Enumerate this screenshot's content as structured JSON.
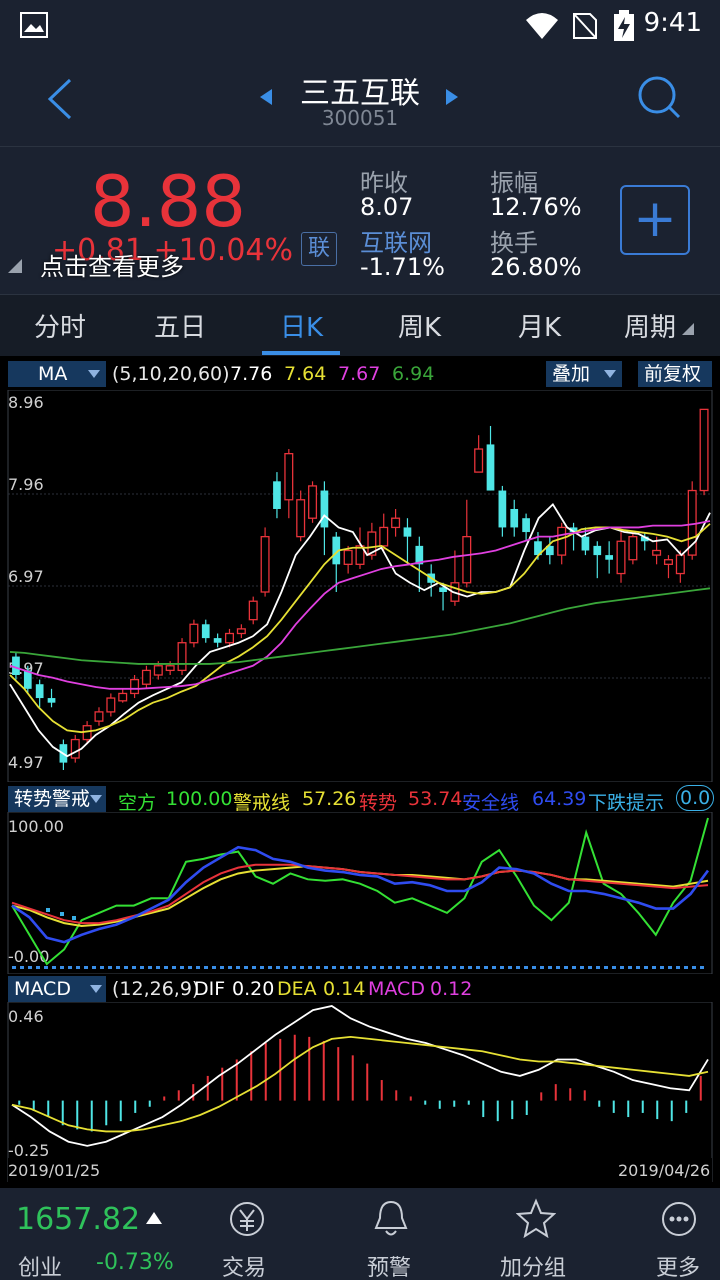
{
  "status": {
    "time": "9:41"
  },
  "header": {
    "name": "三五互联",
    "code": "300051"
  },
  "quote": {
    "price": "8.88",
    "change": "+0.81  +10.04%",
    "hint": "点击查看更多",
    "badge": "联",
    "prev_close_label": "昨收",
    "prev_close": "8.07",
    "sector_label": "互联网",
    "sector_change": "-1.71%",
    "amplitude_label": "振幅",
    "amplitude": "12.76%",
    "turnover_label": "换手",
    "turnover": "26.80%"
  },
  "tabs": [
    "分时",
    "五日",
    "日K",
    "周K",
    "月K",
    "周期"
  ],
  "ma_row": {
    "selector": "MA",
    "params": "(5,10,20,60)",
    "v1": "7.76",
    "v2": "7.64",
    "v3": "7.67",
    "v4": "6.94",
    "overlay": "叠加",
    "adjust": "前复权"
  },
  "trend_row": {
    "selector": "转势警戒",
    "l1": "空方",
    "v1": "100.00",
    "l2": "警戒线",
    "v2": "57.26",
    "l3": "转势",
    "v3": "53.74",
    "l4": "安全线",
    "v4": "64.39",
    "l5": "下跌提示",
    "v5": "0.0"
  },
  "macd_row": {
    "selector": "MACD",
    "params": "(12,26,9)",
    "dif_label": "DIF",
    "dif": "0.20",
    "dea_label": "DEA",
    "dea": "0.14",
    "macd_label": "MACD",
    "macd": "0.12"
  },
  "axes": {
    "price_ticks": [
      "8.96",
      "7.96",
      "6.97",
      "5.97",
      "4.97"
    ],
    "trend_ticks": [
      "100.00",
      "-0.00"
    ],
    "macd_ticks": [
      "0.46",
      "-0.25"
    ],
    "start_date": "2019/01/25",
    "end_date": "2019/04/26"
  },
  "bottom": {
    "index_value": "1657.82",
    "index_name": "创业",
    "index_change": "-0.73%",
    "nav": [
      "交易",
      "预警",
      "加分组",
      "更多"
    ]
  },
  "colors": {
    "up": "#e8333a",
    "down": "#4fe6e6",
    "ma5": "#ffffff",
    "ma10": "#e6e034",
    "ma20": "#e040e0",
    "ma60": "#3aa63a"
  },
  "chart_data": [
    {
      "type": "line",
      "title": "",
      "ylim": [
        4.97,
        8.96
      ],
      "series": [
        {
          "name": "MA5",
          "values": [
            5.9,
            5.65,
            5.4,
            5.22,
            5.12,
            5.2,
            5.35,
            5.45,
            5.58,
            5.7,
            5.78,
            5.85,
            5.92,
            6.1,
            6.25,
            6.3,
            6.35,
            6.42,
            6.55,
            6.9,
            7.3,
            7.5,
            7.73,
            7.6,
            7.55,
            7.3,
            7.38,
            7.1,
            7.0,
            6.92,
            7.0,
            6.9,
            6.85,
            6.9,
            6.9,
            6.95,
            7.35,
            7.7,
            7.85,
            7.6,
            7.5,
            7.57,
            7.6,
            7.55,
            7.53,
            7.45,
            7.47,
            7.3,
            7.45,
            7.76
          ]
        },
        {
          "name": "MA10",
          "values": [
            6.0,
            5.85,
            5.65,
            5.5,
            5.4,
            5.38,
            5.4,
            5.45,
            5.52,
            5.62,
            5.7,
            5.75,
            5.82,
            5.88,
            6.0,
            6.12,
            6.2,
            6.3,
            6.42,
            6.6,
            6.8,
            7.0,
            7.2,
            7.35,
            7.38,
            7.38,
            7.4,
            7.3,
            7.2,
            7.1,
            7.0,
            6.95,
            6.9,
            6.88,
            6.9,
            6.95,
            7.1,
            7.3,
            7.45,
            7.5,
            7.58,
            7.6,
            7.6,
            7.57,
            7.55,
            7.53,
            7.5,
            7.45,
            7.5,
            7.64
          ]
        },
        {
          "name": "MA20",
          "values": [
            6.1,
            6.05,
            6.0,
            5.97,
            5.93,
            5.9,
            5.87,
            5.85,
            5.85,
            5.85,
            5.86,
            5.87,
            5.88,
            5.9,
            5.95,
            6.0,
            6.05,
            6.1,
            6.2,
            6.35,
            6.55,
            6.72,
            6.88,
            7.0,
            7.05,
            7.1,
            7.15,
            7.18,
            7.2,
            7.23,
            7.25,
            7.28,
            7.3,
            7.32,
            7.35,
            7.4,
            7.45,
            7.5,
            7.5,
            7.53,
            7.55,
            7.58,
            7.6,
            7.6,
            7.6,
            7.62,
            7.62,
            7.62,
            7.64,
            7.67
          ]
        },
        {
          "name": "MA60",
          "values": [
            6.25,
            6.24,
            6.22,
            6.2,
            6.18,
            6.16,
            6.15,
            6.14,
            6.13,
            6.12,
            6.12,
            6.12,
            6.12,
            6.12,
            6.12,
            6.13,
            6.14,
            6.16,
            6.18,
            6.2,
            6.22,
            6.24,
            6.26,
            6.28,
            6.3,
            6.32,
            6.34,
            6.36,
            6.38,
            6.4,
            6.42,
            6.44,
            6.47,
            6.5,
            6.53,
            6.56,
            6.6,
            6.64,
            6.68,
            6.72,
            6.75,
            6.78,
            6.8,
            6.82,
            6.84,
            6.86,
            6.88,
            6.9,
            6.92,
            6.94
          ]
        }
      ],
      "candles": [
        [
          6.2,
          6.0,
          6.25,
          5.95
        ],
        [
          6.05,
          5.85,
          6.1,
          5.8
        ],
        [
          5.9,
          5.75,
          5.95,
          5.65
        ],
        [
          5.75,
          5.7,
          5.85,
          5.65
        ],
        [
          5.25,
          5.05,
          5.3,
          4.97
        ],
        [
          5.1,
          5.3,
          5.35,
          5.05
        ],
        [
          5.3,
          5.45,
          5.5,
          5.25
        ],
        [
          5.5,
          5.6,
          5.65,
          5.45
        ],
        [
          5.6,
          5.75,
          5.8,
          5.55
        ],
        [
          5.72,
          5.8,
          5.85,
          5.7
        ],
        [
          5.8,
          5.95,
          6.0,
          5.75
        ],
        [
          5.9,
          6.05,
          6.1,
          5.85
        ],
        [
          6.0,
          6.1,
          6.15,
          5.95
        ],
        [
          6.05,
          6.1,
          6.15,
          6.0
        ],
        [
          6.05,
          6.35,
          6.4,
          6.0
        ],
        [
          6.35,
          6.55,
          6.6,
          6.3
        ],
        [
          6.55,
          6.4,
          6.6,
          6.35
        ],
        [
          6.4,
          6.35,
          6.45,
          6.3
        ],
        [
          6.35,
          6.45,
          6.5,
          6.3
        ],
        [
          6.45,
          6.5,
          6.55,
          6.4
        ],
        [
          6.6,
          6.8,
          6.85,
          6.55
        ],
        [
          6.9,
          7.5,
          7.6,
          6.85
        ],
        [
          8.1,
          7.8,
          8.2,
          7.7
        ],
        [
          7.9,
          8.4,
          8.45,
          7.7
        ],
        [
          7.5,
          7.9,
          8.0,
          7.45
        ],
        [
          7.7,
          8.05,
          8.1,
          7.65
        ],
        [
          8.0,
          7.6,
          8.1,
          7.3
        ],
        [
          7.5,
          7.2,
          7.55,
          6.9
        ],
        [
          7.2,
          7.35,
          7.4,
          7.1
        ],
        [
          7.2,
          7.4,
          7.6,
          7.15
        ],
        [
          7.3,
          7.55,
          7.65,
          7.25
        ],
        [
          7.4,
          7.6,
          7.75,
          7.35
        ],
        [
          7.6,
          7.7,
          7.8,
          7.5
        ],
        [
          7.6,
          7.5,
          7.7,
          7.2
        ],
        [
          7.4,
          7.2,
          7.5,
          6.9
        ],
        [
          7.1,
          7.0,
          7.2,
          6.85
        ],
        [
          6.95,
          6.9,
          7.0,
          6.7
        ],
        [
          6.8,
          7.0,
          7.35,
          6.75
        ],
        [
          7.0,
          7.5,
          7.9,
          6.95
        ],
        [
          8.2,
          8.45,
          8.6,
          8.2
        ],
        [
          8.5,
          8.0,
          8.7,
          8.0
        ],
        [
          8.0,
          7.6,
          8.05,
          7.5
        ],
        [
          7.8,
          7.6,
          7.9,
          7.5
        ],
        [
          7.7,
          7.55,
          7.75,
          7.45
        ],
        [
          7.45,
          7.3,
          7.55,
          7.25
        ],
        [
          7.4,
          7.3,
          7.5,
          7.2
        ],
        [
          7.3,
          7.6,
          7.65,
          7.2
        ],
        [
          7.6,
          7.55,
          7.65,
          7.35
        ],
        [
          7.5,
          7.35,
          7.6,
          7.3
        ],
        [
          7.4,
          7.3,
          7.45,
          7.05
        ],
        [
          7.3,
          7.25,
          7.45,
          7.1
        ],
        [
          7.1,
          7.45,
          7.55,
          7.0
        ],
        [
          7.25,
          7.5,
          7.55,
          7.2
        ],
        [
          7.5,
          7.45,
          7.55,
          7.35
        ],
        [
          7.3,
          7.35,
          7.5,
          7.2
        ],
        [
          7.2,
          7.25,
          7.3,
          7.05
        ],
        [
          7.1,
          7.3,
          7.35,
          7.0
        ],
        [
          7.3,
          8.0,
          8.1,
          7.25
        ],
        [
          8.0,
          8.88,
          8.88,
          7.95
        ]
      ]
    },
    {
      "type": "line",
      "title": "",
      "ylim": [
        0,
        100
      ],
      "series": [
        {
          "name": "空方",
          "values": [
            40,
            20,
            0,
            10,
            30,
            35,
            40,
            40,
            45,
            45,
            70,
            72,
            75,
            77,
            60,
            55,
            62,
            58,
            57,
            58,
            55,
            50,
            42,
            45,
            40,
            35,
            45,
            70,
            78,
            60,
            40,
            30,
            42,
            90,
            55,
            48,
            35,
            20,
            42,
            57,
            100
          ]
        },
        {
          "name": "警戒线",
          "values": [
            40,
            37,
            32,
            28,
            26,
            27,
            29,
            32,
            35,
            38,
            45,
            52,
            58,
            62,
            64,
            65,
            66,
            67,
            66,
            65,
            63,
            62,
            61,
            61,
            60,
            59,
            58,
            60,
            63,
            64,
            63,
            61,
            58,
            58,
            57,
            56,
            55,
            54,
            53,
            55,
            57
          ]
        },
        {
          "name": "转势",
          "values": [
            42,
            38,
            34,
            30,
            28,
            28,
            30,
            33,
            36,
            40,
            48,
            56,
            62,
            66,
            68,
            68,
            68,
            67,
            66,
            65,
            63,
            62,
            61,
            60,
            59,
            58,
            58,
            60,
            63,
            64,
            63,
            61,
            58,
            57,
            56,
            55,
            54,
            53,
            52,
            53,
            54
          ]
        },
        {
          "name": "安全线",
          "values": [
            40,
            32,
            18,
            15,
            20,
            24,
            27,
            32,
            38,
            44,
            56,
            66,
            73,
            80,
            78,
            72,
            70,
            66,
            64,
            63,
            61,
            60,
            55,
            56,
            54,
            50,
            50,
            56,
            66,
            65,
            62,
            55,
            50,
            50,
            48,
            45,
            42,
            38,
            38,
            48,
            64
          ]
        }
      ]
    },
    {
      "type": "bar",
      "title": "",
      "ylim": [
        -0.25,
        0.46
      ],
      "series": [
        {
          "name": "MACD",
          "values": [
            -0.02,
            -0.05,
            -0.08,
            -0.12,
            -0.14,
            -0.15,
            -0.12,
            -0.1,
            -0.06,
            -0.03,
            0.02,
            0.05,
            0.08,
            0.12,
            0.16,
            0.2,
            0.24,
            0.28,
            0.3,
            0.32,
            0.31,
            0.29,
            0.26,
            0.22,
            0.18,
            0.1,
            0.05,
            0.02,
            -0.02,
            -0.04,
            -0.03,
            -0.02,
            -0.08,
            -0.1,
            -0.09,
            -0.07,
            0.04,
            0.08,
            0.06,
            0.05,
            -0.03,
            -0.06,
            -0.08,
            -0.06,
            -0.09,
            -0.1,
            -0.06,
            0.12
          ]
        },
        {
          "name": "DIF",
          "values": [
            -0.02,
            -0.08,
            -0.15,
            -0.2,
            -0.22,
            -0.2,
            -0.16,
            -0.12,
            -0.08,
            -0.02,
            0.05,
            0.12,
            0.18,
            0.25,
            0.32,
            0.38,
            0.44,
            0.46,
            0.4,
            0.36,
            0.33,
            0.3,
            0.28,
            0.25,
            0.22,
            0.18,
            0.14,
            0.12,
            0.15,
            0.2,
            0.2,
            0.17,
            0.14,
            0.1,
            0.08,
            0.06,
            0.05,
            0.2
          ]
        },
        {
          "name": "DEA",
          "values": [
            -0.02,
            -0.04,
            -0.08,
            -0.12,
            -0.14,
            -0.15,
            -0.15,
            -0.14,
            -0.12,
            -0.1,
            -0.07,
            -0.03,
            0.02,
            0.07,
            0.13,
            0.2,
            0.26,
            0.3,
            0.31,
            0.3,
            0.29,
            0.28,
            0.27,
            0.26,
            0.25,
            0.24,
            0.22,
            0.2,
            0.19,
            0.19,
            0.18,
            0.17,
            0.16,
            0.15,
            0.14,
            0.13,
            0.12,
            0.14
          ]
        }
      ]
    }
  ]
}
